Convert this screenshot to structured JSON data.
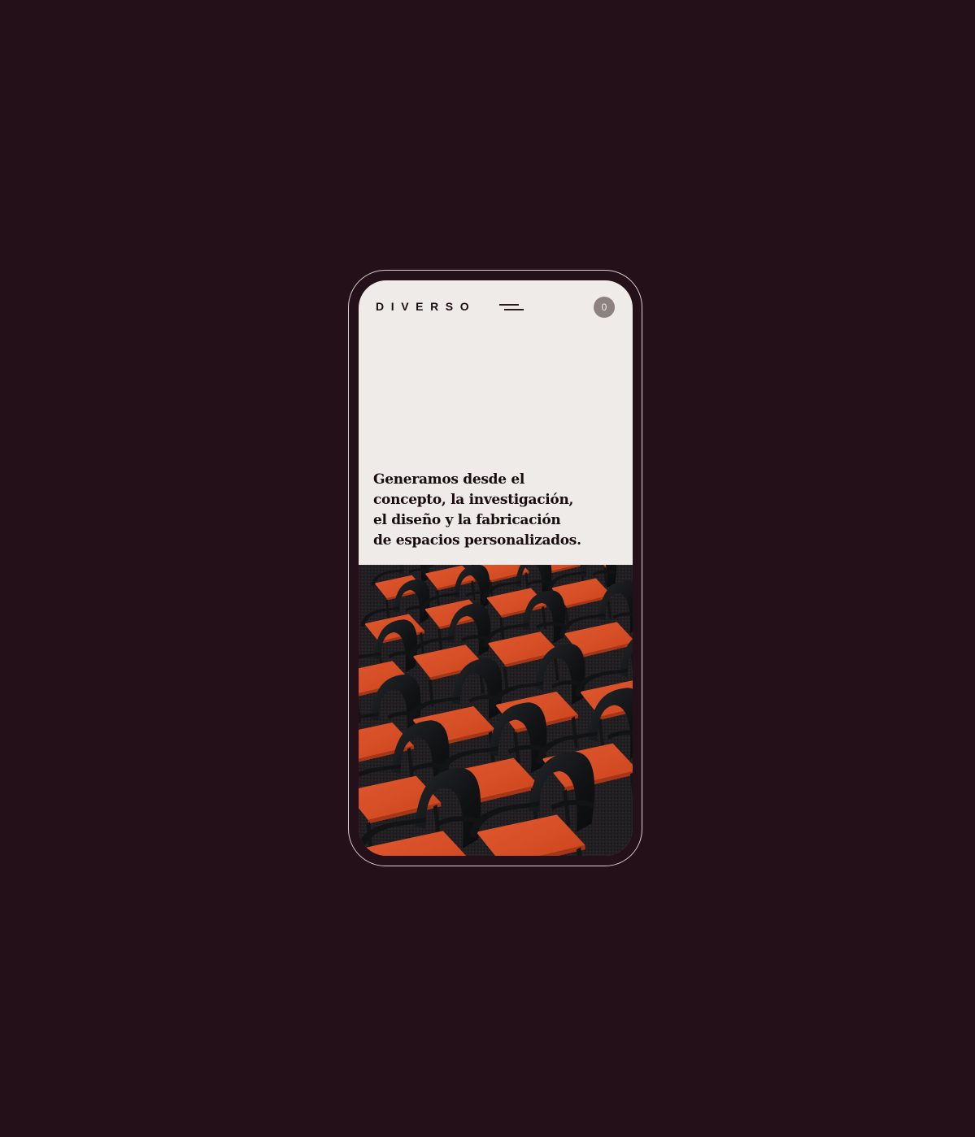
{
  "brand": {
    "logo_text": "DIVERSO"
  },
  "header": {
    "menu_icon": "hamburger-menu-icon",
    "cart_count": "0"
  },
  "hero": {
    "headline_lines": [
      "Generamos desde el",
      "concepto, la investigación,",
      "el diseño y la fabricación",
      "de espacios personalizados."
    ]
  },
  "image": {
    "subject": "rows of black chairs with orange seats",
    "colors": {
      "seat": "#e8542a",
      "backrest": "#141618",
      "floor": "#262326"
    }
  },
  "colors": {
    "page_background": "#241018",
    "screen_background": "#efebe8",
    "text": "#1a0d10",
    "badge": "#8c8280"
  }
}
